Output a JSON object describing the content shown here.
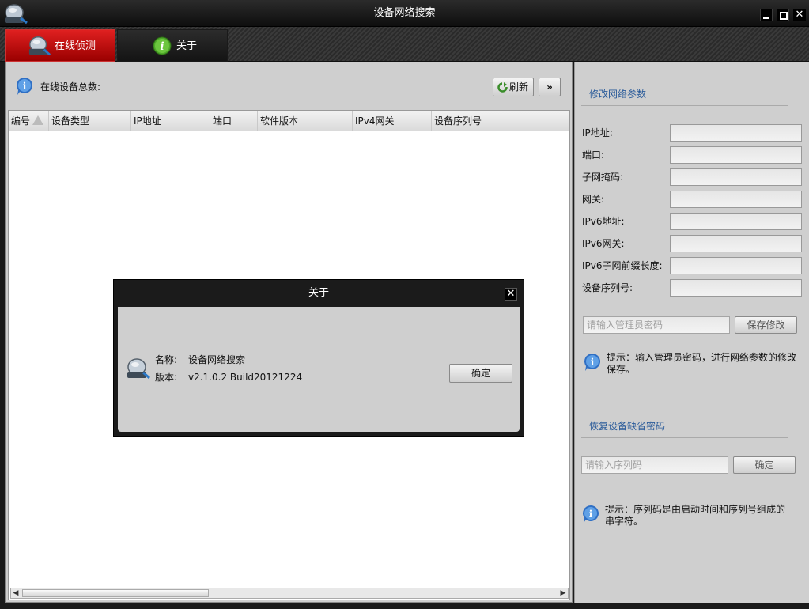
{
  "window": {
    "title": "设备网络搜索",
    "controls": {
      "minimize": "",
      "maximize": "",
      "close": "✕"
    }
  },
  "tabs": [
    {
      "label": "在线侦测",
      "active": true
    },
    {
      "label": "关于",
      "active": false
    }
  ],
  "main": {
    "total_label": "在线设备总数:",
    "refresh_label": "刷新",
    "more_label": "»",
    "table": {
      "columns": [
        "编号",
        "设备类型",
        "IP地址",
        "端口",
        "软件版本",
        "IPv4网关",
        "设备序列号"
      ],
      "rows": []
    }
  },
  "network": {
    "title": "修改网络参数",
    "fields": [
      {
        "label": "IP地址:",
        "value": ""
      },
      {
        "label": "端口:",
        "value": ""
      },
      {
        "label": "子网掩码:",
        "value": ""
      },
      {
        "label": "网关:",
        "value": ""
      },
      {
        "label": "IPv6地址:",
        "value": ""
      },
      {
        "label": "IPv6网关:",
        "value": ""
      },
      {
        "label": "IPv6子网前缀长度:",
        "value": ""
      },
      {
        "label": "设备序列号:",
        "value": ""
      }
    ],
    "password_placeholder": "请输入管理员密码",
    "save_label": "保存修改",
    "tip_line1": "提示：输入管理员密码，进行网络参数的修改",
    "tip_line2": "保存。"
  },
  "restore": {
    "title": "恢复设备缺省密码",
    "serial_placeholder": "请输入序列码",
    "confirm_label": "确定",
    "tip_line1": "提示：序列码是由启动时间和序列号组成的一",
    "tip_line2": "串字符。"
  },
  "about_dialog": {
    "title": "关于",
    "close": "✕",
    "name_key": "名称:",
    "name_value": "设备网络搜索",
    "version_key": "版本:",
    "version_value": "v2.1.0.2 Build20121224",
    "ok_label": "确定"
  },
  "colors": {
    "active_tab": "#d41414",
    "section_title": "#2a5b9a",
    "panel_bg": "#cfcfcf",
    "titlebar": "#111111"
  },
  "icons": {
    "app": "device-search-icon",
    "info": "info-icon",
    "about_tab": "info-green-icon",
    "refresh": "refresh-icon"
  }
}
